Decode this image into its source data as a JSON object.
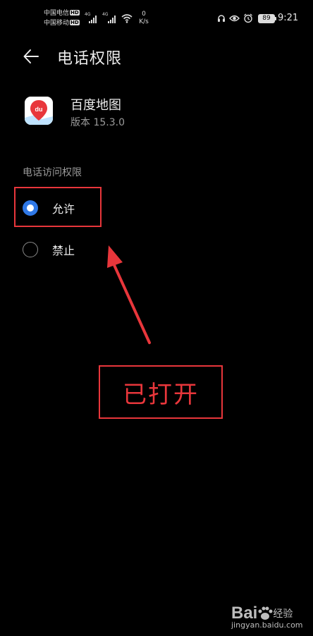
{
  "status_bar": {
    "carrier_1": "中国电信",
    "carrier_2": "中国移动",
    "hd_label": "HD",
    "net_tag": "4G",
    "speed_value": "0",
    "speed_unit": "K/s",
    "battery_level": "89",
    "time": "9:21"
  },
  "header": {
    "title": "电话权限"
  },
  "app": {
    "name": "百度地图",
    "version": "版本 15.3.0",
    "icon_text": "du"
  },
  "section": {
    "label": "电话访问权限"
  },
  "options": [
    {
      "label": "允许",
      "selected": true
    },
    {
      "label": "禁止",
      "selected": false
    }
  ],
  "annotation": {
    "callout": "已打开",
    "colors": {
      "highlight": "#e8363b"
    }
  },
  "watermark": {
    "logo": "Bai",
    "logo_suffix": "经验",
    "url": "jingyan.baidu.com"
  },
  "colors": {
    "accent": "#2f78e6",
    "background": "#000000"
  }
}
